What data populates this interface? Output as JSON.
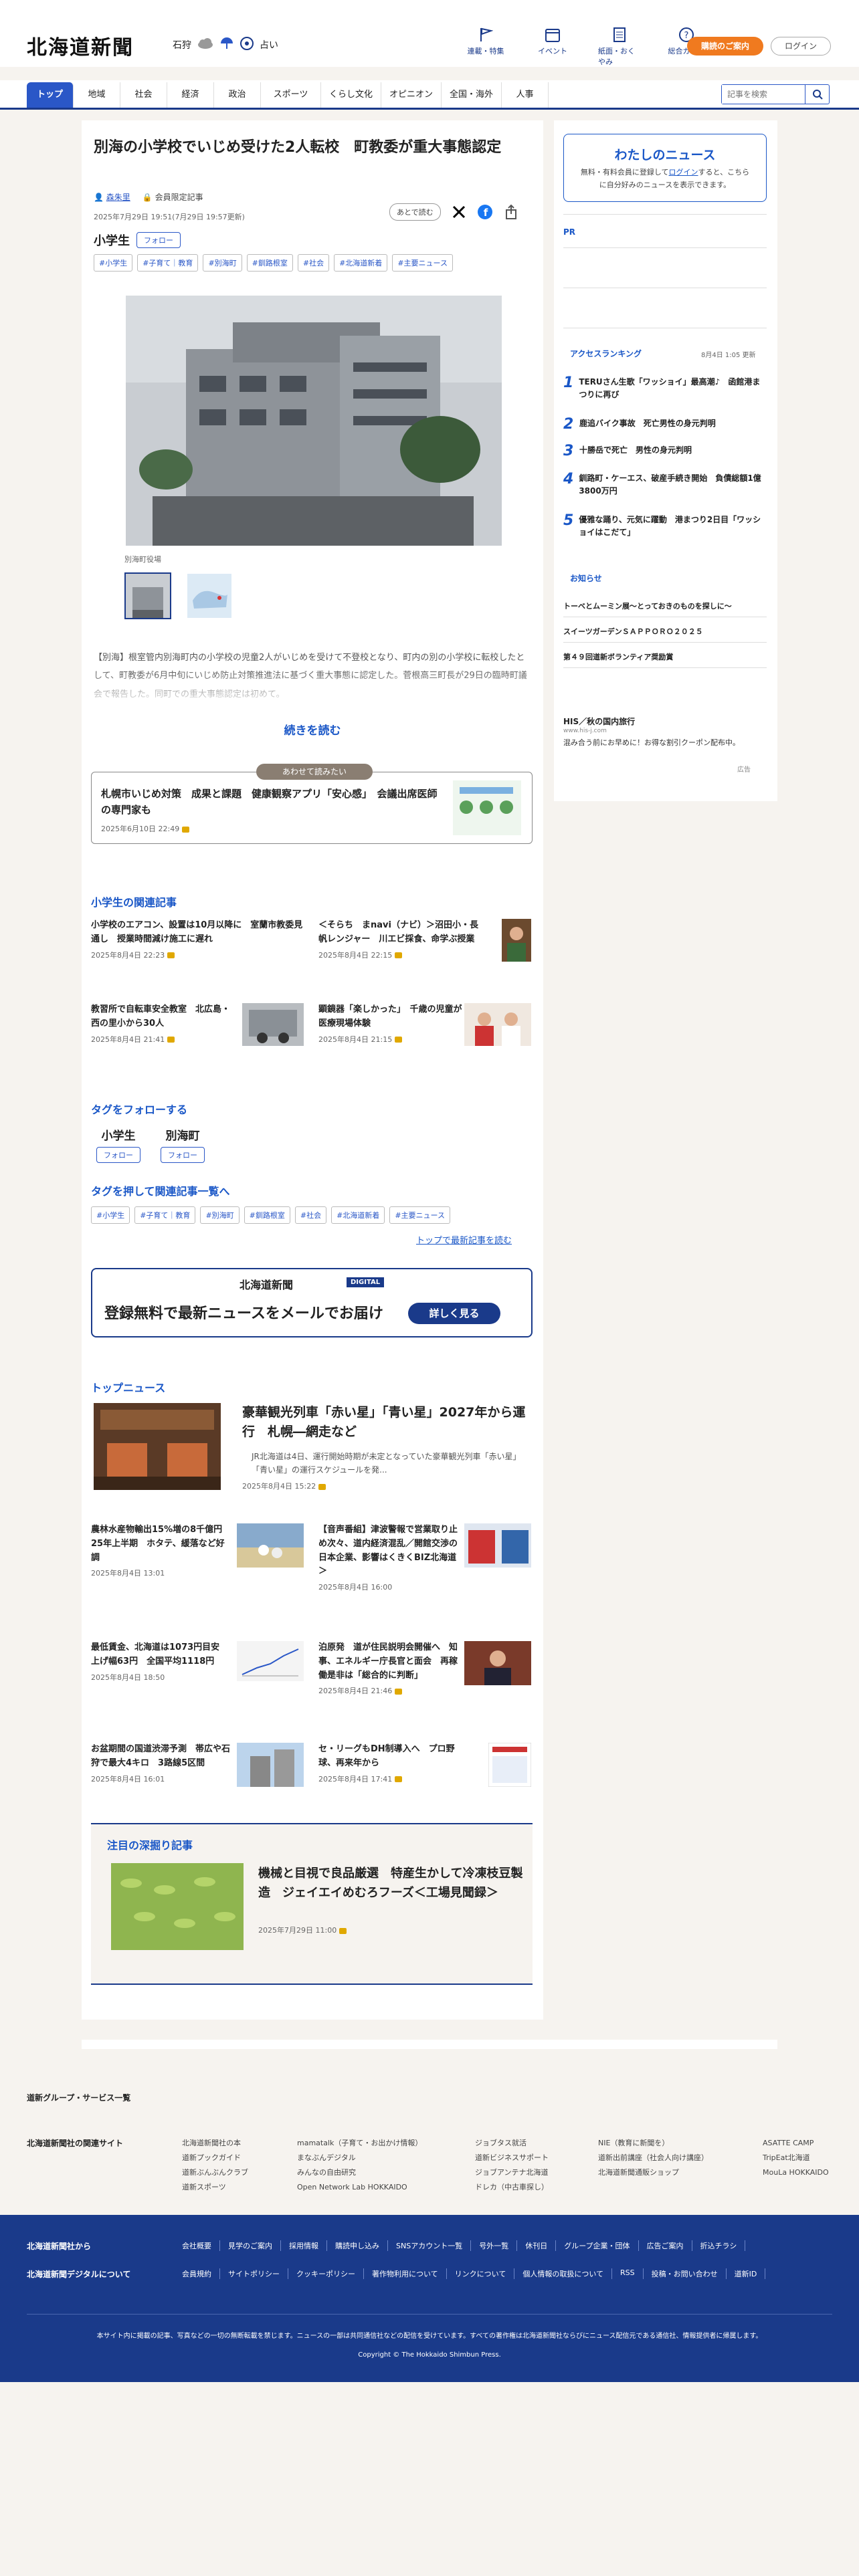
{
  "header": {
    "logo": "北海道新聞",
    "weather_region": "石狩",
    "weather_label": "占い",
    "icons": [
      {
        "label": "連載・特集",
        "icon": "flag-icon"
      },
      {
        "label": "イベント",
        "icon": "calendar-icon"
      },
      {
        "label": "紙面・おくやみ",
        "icon": "newspaper-icon"
      },
      {
        "label": "総合ガイド",
        "icon": "question-icon"
      }
    ],
    "signup": "購読のご案内",
    "login": "ログイン"
  },
  "nav": {
    "items": [
      "トップ",
      "地域",
      "社会",
      "経済",
      "政治",
      "スポーツ",
      "くらし文化",
      "オピニオン",
      "全国・海外",
      "人事"
    ],
    "search_placeholder": "記事を検索"
  },
  "article": {
    "headline": "別海の小学校でいじめ受けた2人転校　町教委が重大事態認定",
    "author": "森朱里",
    "member_label": "会員限定記事",
    "date": "2025年7月29日 19:51(7月29日 19:57更新)",
    "save_label": "あとで読む",
    "topic": "小学生",
    "follow": "フォロー",
    "tags": [
      "#小学生",
      "#子育て｜教育",
      "#別海町",
      "#釧路根室",
      "#社会",
      "#北海道新着",
      "#主要ニュース"
    ],
    "caption": "別海町役場",
    "lead": "【別海】根室管内別海町内の小学校の児童2人がいじめを受けて不登校となり、町内の別の小学校に転校したとして、町教委が6月中旬にいじめ防止対策推進法に基づく重大事態に認定した。菅根高三町長が29日の臨時町議会で報告した。同町での重大事態認定は初めて。",
    "read_more": "続きを読む"
  },
  "also_read": {
    "badge": "あわせて読みたい",
    "title": "札幌市いじめ対策　成果と課題　健康観察アプリ「安心感」　会議出席医師の専門家も",
    "date": "2025年6月10日 22:49"
  },
  "related": {
    "heading": "小学生の関連記事",
    "items": [
      {
        "title": "小学校のエアコン、設置は10月以降に　室蘭市教委見通し　授業時間減け施工に遅れ",
        "date": "2025年8月4日 22:23"
      },
      {
        "title": "＜そらち　まnavi（ナビ）＞沼田小・長帆レンジャー　川エビ採食、命学ぶ授業",
        "date": "2025年8月4日 22:15"
      },
      {
        "title": "教習所で自転車安全教室　北広島・西の里小から30人",
        "date": "2025年8月4日 21:41"
      },
      {
        "title": "顕鏡器「楽しかった」　千歳の児童が医療現場体験",
        "date": "2025年8月4日 21:15"
      }
    ]
  },
  "follow_tags": {
    "heading": "タグをフォローする",
    "items": [
      {
        "name": "小学生",
        "btn": "フォロー"
      },
      {
        "name": "別海町",
        "btn": "フォロー"
      }
    ]
  },
  "tag_search": {
    "heading": "タグを押して関連記事一覧へ",
    "tags": [
      "#小学生",
      "#子育て｜教育",
      "#別海町",
      "#釧路根室",
      "#社会",
      "#北海道新着",
      "#主要ニュース"
    ],
    "more": "トップで最新記事を読む"
  },
  "mail_banner": {
    "logo": "北海道新聞",
    "digital": "DIGITAL",
    "text": "登録無料で最新ニュースをメールでお届け",
    "button": "詳しく見る"
  },
  "top_news": {
    "heading": "トップニュース",
    "main": {
      "title": "豪華観光列車「赤い星」「青い星」2027年から運行　札幌―網走など",
      "lead": "JR北海道は4日、運行開始時期が未定となっていた豪華観光列車「赤い星」「青い星」の運行スケジュールを発...",
      "date": "2025年8月4日 15:22"
    },
    "items": [
      {
        "title": "農林水産物輸出15%増の8千億円　25年上半期　ホタテ、緩落など好調",
        "date": "2025年8月4日 13:01"
      },
      {
        "title": "【音声番組】津波警報で営業取り止め次々、道内経済混乱／開館交渉の日本企業、影響はくきくBIZ北海道＞",
        "date": "2025年8月4日 16:00"
      },
      {
        "title": "最低賃金、北海道は1073円目安　上げ幅63円　全国平均1118円",
        "date": "2025年8月4日 18:50"
      },
      {
        "title": "泊原発　道が住民説明会開催へ　知事、エネルギー庁長官と面会　再稼働是非は「総合的に判断」",
        "date": "2025年8月4日 21:46"
      },
      {
        "title": "お盆期間の国道渋滞予測　帯広や石狩で最大4キロ　3路線5区間",
        "date": "2025年8月4日 16:01"
      },
      {
        "title": "セ・リーグもDH制導入へ　プロ野球、再来年から",
        "date": "2025年8月4日 17:41"
      }
    ]
  },
  "feature": {
    "heading": "注目の深掘り記事",
    "title": "機械と目視で良品厳選　特産生かして冷凍枝豆製造　ジェイエイめむろフーズ＜工場見聞録＞",
    "date": "2025年7月29日 11:00"
  },
  "sidebar": {
    "mynews_title": "わたしのニュース",
    "mynews_pre": "無料・有料会員に登録して",
    "mynews_link": "ログイン",
    "mynews_post": "すると、こちらに自分好みのニュースを表示できます。",
    "pr": "PR",
    "ranking_heading": "アクセスランキング",
    "ranking_updated": "8月4日 1:05 更新",
    "ranking": [
      {
        "num": "1",
        "title": "TERUさん生歌「ワッショイ」最高潮♪　函館港まつりに再び"
      },
      {
        "num": "2",
        "title": "鹿追バイク事故　死亡男性の身元判明"
      },
      {
        "num": "3",
        "title": "十勝岳で死亡　男性の身元判明"
      },
      {
        "num": "4",
        "title": "釧路町・ケーエス、破産手続き開始　負債総額1億3800万円"
      },
      {
        "num": "5",
        "title": "優雅な踊り、元気に躍動　港まつり2日目「ワッショイはこだて」"
      }
    ],
    "notice_heading": "お知らせ",
    "notices": [
      "トーベとムーミン展～とっておきのものを探しに～",
      "スイーツガーデンＳＡＰＰＯＲＯ２０２５",
      "第４９回道新ボランティア奨励賞"
    ],
    "ad_title": "HIS／秋の国内旅行",
    "ad_url": "www.his-j.com",
    "ad_text": "混み合う前にお早めに！お得な割引クーポン配布中。",
    "ad_label": "広告"
  },
  "footer": {
    "group_link": "道新グループ・サービス一覧",
    "related_heading": "北海道新聞社の関連サイト",
    "cols": [
      [
        "北海道新聞社の本",
        "道新プックガイド",
        "道新ぶんぶんクラブ",
        "道新スポーツ"
      ],
      [
        "mamatalk（子育て・お出かけ情報）",
        "まなぶんデジタル",
        "みんなの自由研究",
        "Open Network Lab HOKKAIDO"
      ],
      [
        "ジョブタス就活",
        "道新ビジネスサポート",
        "ジョブアンテナ北海道",
        "ドレカ（中古車探し）"
      ],
      [
        "NIE（教育に新聞を）",
        "道新出前講座（社会人向け講座）",
        "北海道新聞通販ショップ"
      ],
      [
        "ASATTE CAMP",
        "TripEat北海道",
        "MouLa HOKKAIDO"
      ]
    ],
    "company_label": "北海道新聞社から",
    "digital_label": "北海道新聞デジタルについて",
    "company_links": [
      "会社概要",
      "見学のご案内",
      "採用情報",
      "購読申し込み",
      "SNSアカウント一覧",
      "号外一覧",
      "休刊日",
      "グループ企業・団体",
      "広告ご案内",
      "折込チラシ"
    ],
    "digital_links": [
      "会員規約",
      "サイトポリシー",
      "クッキーポリシー",
      "著作物利用について",
      "リンクについて",
      "個人情報の取扱について",
      "RSS",
      "投稿・お問い合わせ",
      "道新ID"
    ],
    "note": "本サイト内に掲載の記事、写真などの一切の無断転載を禁じます。ニュースの一部は共同通信社などの配信を受けています。すべての著作権は北海道新聞社ならびにニュース配信元である通信社、情報提供者に帰属します。",
    "copyright": "Copyright © The Hokkaido Shimbun Press."
  },
  "colors": {
    "brand": "#1a3a8a",
    "accent": "#2a57c7",
    "orange": "#f07a1f",
    "bg": "#f6f3ef"
  }
}
